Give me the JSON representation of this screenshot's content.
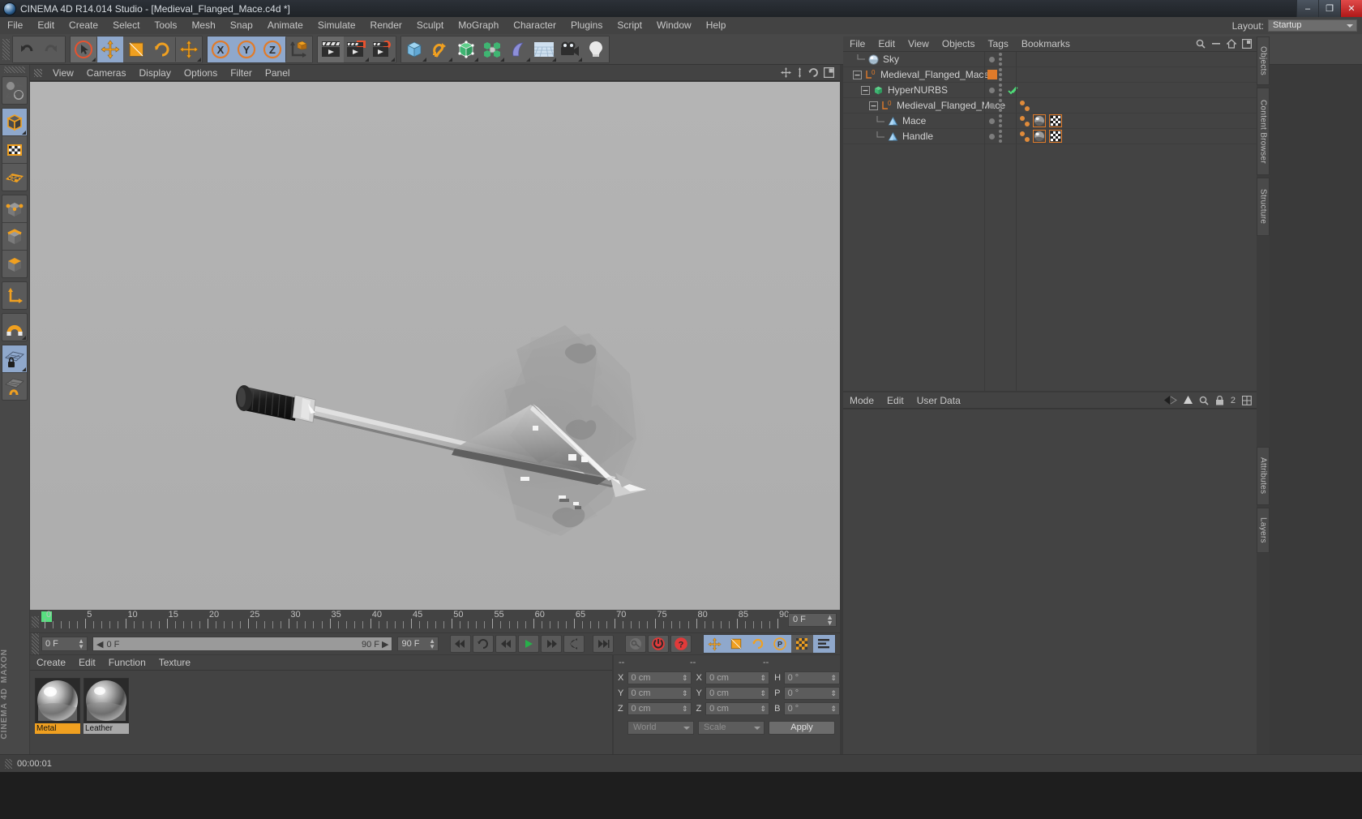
{
  "window": {
    "title": "CINEMA 4D R14.014 Studio - [Medieval_Flanged_Mace.c4d *]",
    "app_icon": "c4d-logo-icon",
    "minimize": "–",
    "maximize": "❐",
    "close": "✕"
  },
  "menubar": {
    "items": [
      "File",
      "Edit",
      "Create",
      "Select",
      "Tools",
      "Mesh",
      "Snap",
      "Animate",
      "Simulate",
      "Render",
      "Sculpt",
      "MoGraph",
      "Character",
      "Plugins",
      "Script",
      "Window",
      "Help"
    ],
    "layout_label": "Layout:",
    "layout_value": "Startup"
  },
  "toolbar": {
    "buttons": [
      {
        "name": "undo-button",
        "icon": "undo-arrow-icon",
        "state": "normal"
      },
      {
        "name": "redo-button",
        "icon": "redo-arrow-icon",
        "state": "disabled"
      },
      {
        "name": "live-selection-button",
        "icon": "cursor-circle-icon",
        "state": "active"
      },
      {
        "name": "move-button",
        "icon": "move-arrows-icon",
        "state": "selected"
      },
      {
        "name": "scale-button",
        "icon": "scale-square-icon",
        "state": "normal"
      },
      {
        "name": "rotate-button",
        "icon": "rotate-circle-icon",
        "state": "normal"
      },
      {
        "name": "move-duplicate-button",
        "icon": "move-arrows-icon",
        "state": "normal"
      },
      {
        "name": "x-axis-lock-button",
        "icon": "axis-x-icon",
        "state": "selected"
      },
      {
        "name": "y-axis-lock-button",
        "icon": "axis-y-icon",
        "state": "selected"
      },
      {
        "name": "z-axis-lock-button",
        "icon": "axis-z-icon",
        "state": "selected"
      },
      {
        "name": "world-object-coordinates-button",
        "icon": "world-axis-cube-icon",
        "state": "normal"
      },
      {
        "name": "render-view-button",
        "icon": "clapper-play-icon",
        "state": "active"
      },
      {
        "name": "render-to-picture-viewer-button",
        "icon": "clapper-picture-icon",
        "state": "normal"
      },
      {
        "name": "render-settings-button",
        "icon": "clapper-gear-icon",
        "state": "normal"
      },
      {
        "name": "add-cube-button",
        "icon": "cube-icon",
        "state": "normal"
      },
      {
        "name": "add-spline-button",
        "icon": "spline-pen-icon",
        "state": "normal"
      },
      {
        "name": "add-hypernurbs-button",
        "icon": "hypernurbs-cube-icon",
        "state": "normal"
      },
      {
        "name": "add-array-button",
        "icon": "array-cluster-icon",
        "state": "normal"
      },
      {
        "name": "add-bend-deformer-button",
        "icon": "bend-deformer-icon",
        "state": "normal"
      },
      {
        "name": "add-floor-button",
        "icon": "floor-grid-icon",
        "state": "normal"
      },
      {
        "name": "add-camera-button",
        "icon": "camera-icon",
        "state": "normal"
      },
      {
        "name": "add-light-button",
        "icon": "light-bulb-icon",
        "state": "normal"
      }
    ]
  },
  "left_toolbar": {
    "buttons": [
      {
        "name": "undo-view-button",
        "icon": "globe-undo-icon",
        "state": "normal"
      },
      {
        "name": "model-mode-button",
        "icon": "cube-orange-outline-icon",
        "state": "selected"
      },
      {
        "name": "texture-mode-button",
        "icon": "checker-texture-icon",
        "state": "normal"
      },
      {
        "name": "polygon-mesh-mode-button",
        "icon": "orange-mesh-plane-icon",
        "state": "normal"
      },
      {
        "name": "points-mode-button",
        "icon": "cube-points-icon",
        "state": "normal"
      },
      {
        "name": "edges-mode-button",
        "icon": "cube-edges-icon",
        "state": "normal"
      },
      {
        "name": "polygons-mode-button",
        "icon": "cube-polygons-icon",
        "state": "normal"
      },
      {
        "name": "axis-mode-button",
        "icon": "orange-axis-icon",
        "state": "normal"
      },
      {
        "name": "enable-snap-button",
        "icon": "magnet-icon",
        "state": "normal"
      },
      {
        "name": "workplane-lock-button",
        "icon": "workplane-lock-icon",
        "state": "selected"
      },
      {
        "name": "workplane-mode-button",
        "icon": "workplane-arrows-icon",
        "state": "normal"
      }
    ]
  },
  "branding": {
    "maxon": "MAXON",
    "cinema4d": "CINEMA 4D"
  },
  "viewport": {
    "menu_items": [
      "View",
      "Cameras",
      "Display",
      "Options",
      "Filter",
      "Panel"
    ],
    "corner_icons": [
      "pan-view-icon",
      "dolly-view-icon",
      "rotate-view-icon",
      "maximize-view-icon"
    ],
    "scene_object": "Medieval_Flanged_Mace"
  },
  "timeline": {
    "ticks": [
      0,
      5,
      10,
      15,
      20,
      25,
      30,
      35,
      40,
      45,
      50,
      55,
      60,
      65,
      70,
      75,
      80,
      85,
      90
    ],
    "current_frame_marker": 0,
    "end_field": "0 F"
  },
  "transport": {
    "current_frame": "0 F",
    "range_start": "0 F",
    "range_end": "90 F",
    "preview_end": "90 F",
    "buttons": [
      {
        "name": "go-to-start-button",
        "icon": "skip-start-icon"
      },
      {
        "name": "loop-button",
        "icon": "loop-icon"
      },
      {
        "name": "play-backwards-button",
        "icon": "rewind-icon"
      },
      {
        "name": "play-forwards-button",
        "icon": "play-icon",
        "state": "active"
      },
      {
        "name": "go-to-next-frame-button",
        "icon": "step-forward-icon"
      },
      {
        "name": "step-back-button",
        "icon": "return-icon"
      },
      {
        "name": "go-to-end-button",
        "icon": "skip-end-icon"
      },
      {
        "name": "record-active-objects-button",
        "icon": "key-disabled-icon"
      },
      {
        "name": "autokeying-button",
        "icon": "record-red-icon"
      },
      {
        "name": "keyframe-selection-button",
        "icon": "question-red-icon"
      },
      {
        "name": "position-key-button",
        "icon": "move-arrows-icon",
        "state": "selected"
      },
      {
        "name": "scale-key-button",
        "icon": "scale-square-icon",
        "state": "selected"
      },
      {
        "name": "rotation-key-button",
        "icon": "rotate-circle-icon",
        "state": "selected"
      },
      {
        "name": "param-key-button",
        "icon": "p-circle-icon",
        "state": "selected"
      },
      {
        "name": "pla-key-button",
        "icon": "pla-grid-icon",
        "state": "normal"
      },
      {
        "name": "timeline-toggle-button",
        "icon": "timeline-bars-icon",
        "state": "selected"
      }
    ]
  },
  "material_manager": {
    "menu_items": [
      "Create",
      "Edit",
      "Function",
      "Texture"
    ],
    "materials": [
      {
        "name": "Metal",
        "label_color": "#f0a020",
        "swatch": "metal-sphere"
      },
      {
        "name": "Leather",
        "label_color": "#9a9a9a",
        "swatch": "leather-sphere"
      }
    ]
  },
  "coordinates": {
    "column_headers": [
      "--",
      "--",
      "--"
    ],
    "rows": [
      {
        "pos_label": "X",
        "pos_value": "0 cm",
        "size_label": "X",
        "size_value": "0 cm",
        "rot_label": "H",
        "rot_value": "0 °"
      },
      {
        "pos_label": "Y",
        "pos_value": "0 cm",
        "size_label": "Y",
        "size_value": "0 cm",
        "rot_label": "P",
        "rot_value": "0 °"
      },
      {
        "pos_label": "Z",
        "pos_value": "0 cm",
        "size_label": "Z",
        "size_value": "0 cm",
        "rot_label": "B",
        "rot_value": "0 °"
      }
    ],
    "system_dropdown": "World",
    "mode_dropdown": "Scale",
    "apply_button": "Apply"
  },
  "object_manager": {
    "menu_items": [
      "File",
      "Edit",
      "View",
      "Objects",
      "Tags",
      "Bookmarks"
    ],
    "header_icons": [
      "search-icon",
      "minus-icon",
      "home-icon",
      "layout-icon"
    ],
    "objects": [
      {
        "name": "Sky",
        "icon": "sky-sphere-icon",
        "indent": 0,
        "expander": "none",
        "visible_dots": true,
        "layer_color": null,
        "tags": []
      },
      {
        "name": "Medieval_Flanged_Mace",
        "icon": "null-object-icon",
        "indent": 0,
        "expander": "minus",
        "visible_dots": true,
        "layer_color": "#e07b2a",
        "tags": []
      },
      {
        "name": "HyperNURBS",
        "icon": "hypernurbs-green-icon",
        "indent": 1,
        "expander": "minus",
        "visible_dots": true,
        "layer_color": null,
        "check": "green-check-icon",
        "tags": []
      },
      {
        "name": "Medieval_Flanged_Mace",
        "icon": "null-object-icon",
        "indent": 2,
        "expander": "minus",
        "visible_dots": true,
        "layer_color": null,
        "tags": [
          "tag-dot",
          "tag-dot"
        ]
      },
      {
        "name": "Mace",
        "icon": "polygon-object-icon",
        "indent": 3,
        "expander": "none",
        "visible_dots": true,
        "layer_color": null,
        "tags": [
          "tag-dot",
          "tag-dot",
          "material-tag-icon",
          "uvw-tag-icon"
        ]
      },
      {
        "name": "Handle",
        "icon": "polygon-object-icon",
        "indent": 3,
        "expander": "none",
        "visible_dots": true,
        "layer_color": null,
        "tags": [
          "tag-dot",
          "tag-dot",
          "material-tag-icon",
          "uvw-tag-icon"
        ]
      }
    ]
  },
  "attribute_manager": {
    "menu_items": [
      "Mode",
      "Edit",
      "User Data"
    ],
    "header_icons": [
      "back-arrow-icon",
      "pin-icon",
      "up-arrow-icon",
      "search-icon",
      "lock-icon",
      "two-icon",
      "grid-icon"
    ]
  },
  "right_tabs": [
    {
      "label": "Objects",
      "name": "tab-objects"
    },
    {
      "label": "Content Browser",
      "name": "tab-content-browser"
    },
    {
      "label": "Structure",
      "name": "tab-structure"
    },
    {
      "label": "Attributes",
      "name": "tab-attributes"
    },
    {
      "label": "Layers",
      "name": "tab-layers"
    }
  ],
  "statusbar": {
    "text": "00:00:01"
  },
  "colors": {
    "accent_orange": "#e07b2a",
    "selection_blue": "#8fa8cc",
    "panel_bg": "#434343",
    "toolbar_bg": "#484848",
    "viewport_bg": "#b0b0b0",
    "text": "#c8c8c8",
    "green_key": "#58df80"
  }
}
